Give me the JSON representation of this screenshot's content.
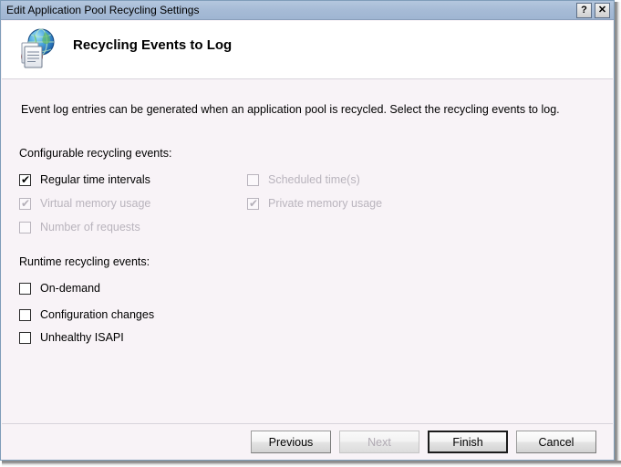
{
  "window": {
    "title": "Edit Application Pool Recycling Settings",
    "title_buttons": [
      {
        "name": "help-button",
        "glyph": "?"
      },
      {
        "name": "close-button",
        "glyph": "✕"
      }
    ]
  },
  "header": {
    "icon": "application-pool-globe-icon",
    "title": "Recycling Events to Log"
  },
  "main": {
    "intro": "Event log entries can be generated when an application pool is recycled. Select the recycling events to log.",
    "configurable_group_label": "Configurable recycling events:",
    "configurable_events_left": [
      {
        "label": "Regular time intervals",
        "checked": true,
        "enabled": true,
        "mark": "✔"
      },
      {
        "label": "Virtual memory usage",
        "checked": true,
        "enabled": false,
        "mark": "✔"
      },
      {
        "label": "Number of requests",
        "checked": false,
        "enabled": false,
        "mark": ""
      }
    ],
    "configurable_events_right": [
      {
        "label": "Scheduled time(s)",
        "checked": false,
        "enabled": false,
        "mark": ""
      },
      {
        "label": "Private memory usage",
        "checked": true,
        "enabled": false,
        "mark": "✔"
      }
    ],
    "runtime_group_label": "Runtime recycling events:",
    "runtime_events": [
      {
        "label": "On-demand",
        "checked": false,
        "enabled": true,
        "mark": ""
      },
      {
        "label": "Configuration changes",
        "checked": false,
        "enabled": true,
        "mark": ""
      },
      {
        "label": "Unhealthy ISAPI",
        "checked": false,
        "enabled": true,
        "mark": ""
      }
    ]
  },
  "footer": {
    "buttons": [
      {
        "label": "Previous",
        "enabled": true,
        "default": false
      },
      {
        "label": "Next",
        "enabled": false,
        "default": false
      },
      {
        "label": "Finish",
        "enabled": true,
        "default": true
      },
      {
        "label": "Cancel",
        "enabled": true,
        "default": false
      }
    ]
  },
  "colors": {
    "titlebar": "#a6bbd6",
    "body_bg": "#f8f3f7",
    "header_bg": "#ffffff",
    "text": "#000000",
    "disabled_text": "#b9b4bd"
  }
}
